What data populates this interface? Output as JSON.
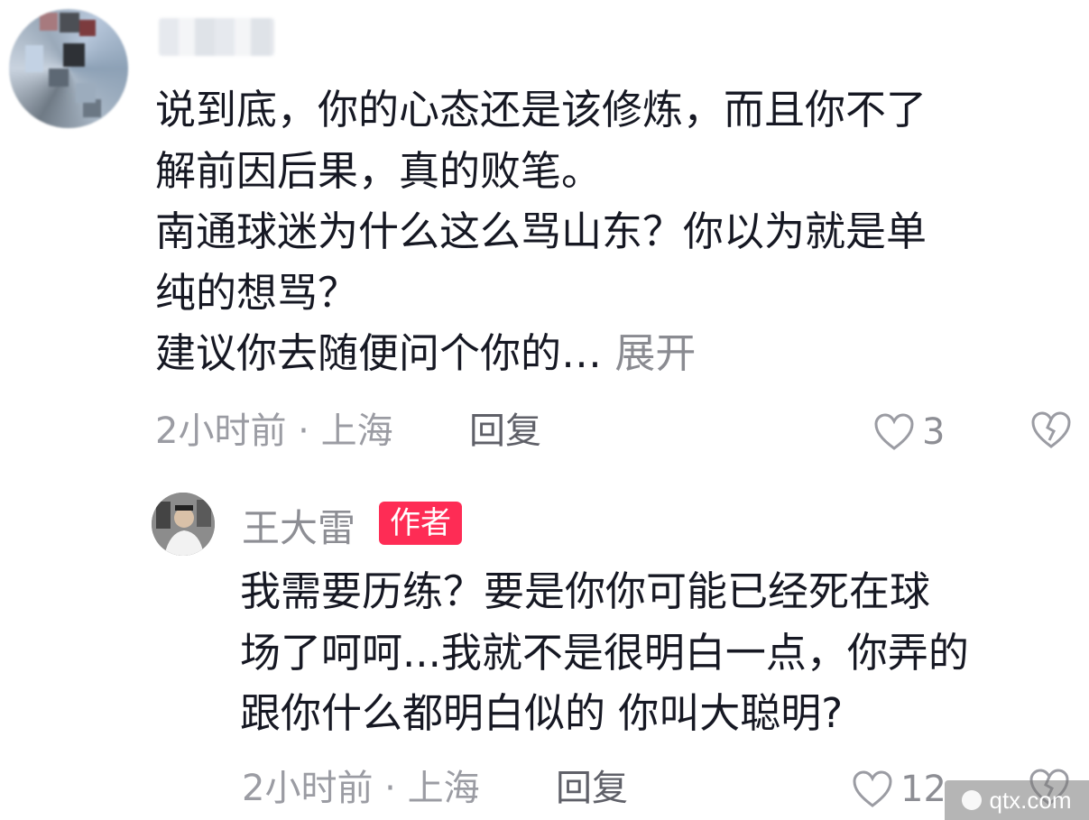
{
  "comment": {
    "lines": [
      "说到底，你的心态还是该修炼，而且你不了",
      "解前因后果，真的败笔。",
      "南通球迷为什么这么骂山东？你以为就是单",
      "纯的想骂？",
      "建议你去随便问个你的…"
    ],
    "expand_label": "展开",
    "time_location": "2小时前 · 上海",
    "reply_label": "回复",
    "like_count": "3"
  },
  "reply": {
    "author": "王大雷",
    "badge": "作者",
    "lines": [
      "我需要历练？要是你你可能已经死在球",
      "场了呵呵...我就不是很明白一点，你弄的",
      "跟你什么都明白似的 你叫大聪明?"
    ],
    "time_location": "2小时前 · 上海",
    "reply_label": "回复",
    "like_count": "12"
  },
  "watermark": {
    "text": "qtx.com"
  },
  "colors": {
    "text": "#161823",
    "secondary": "#9b9ca3",
    "badge": "#fe2c55"
  }
}
